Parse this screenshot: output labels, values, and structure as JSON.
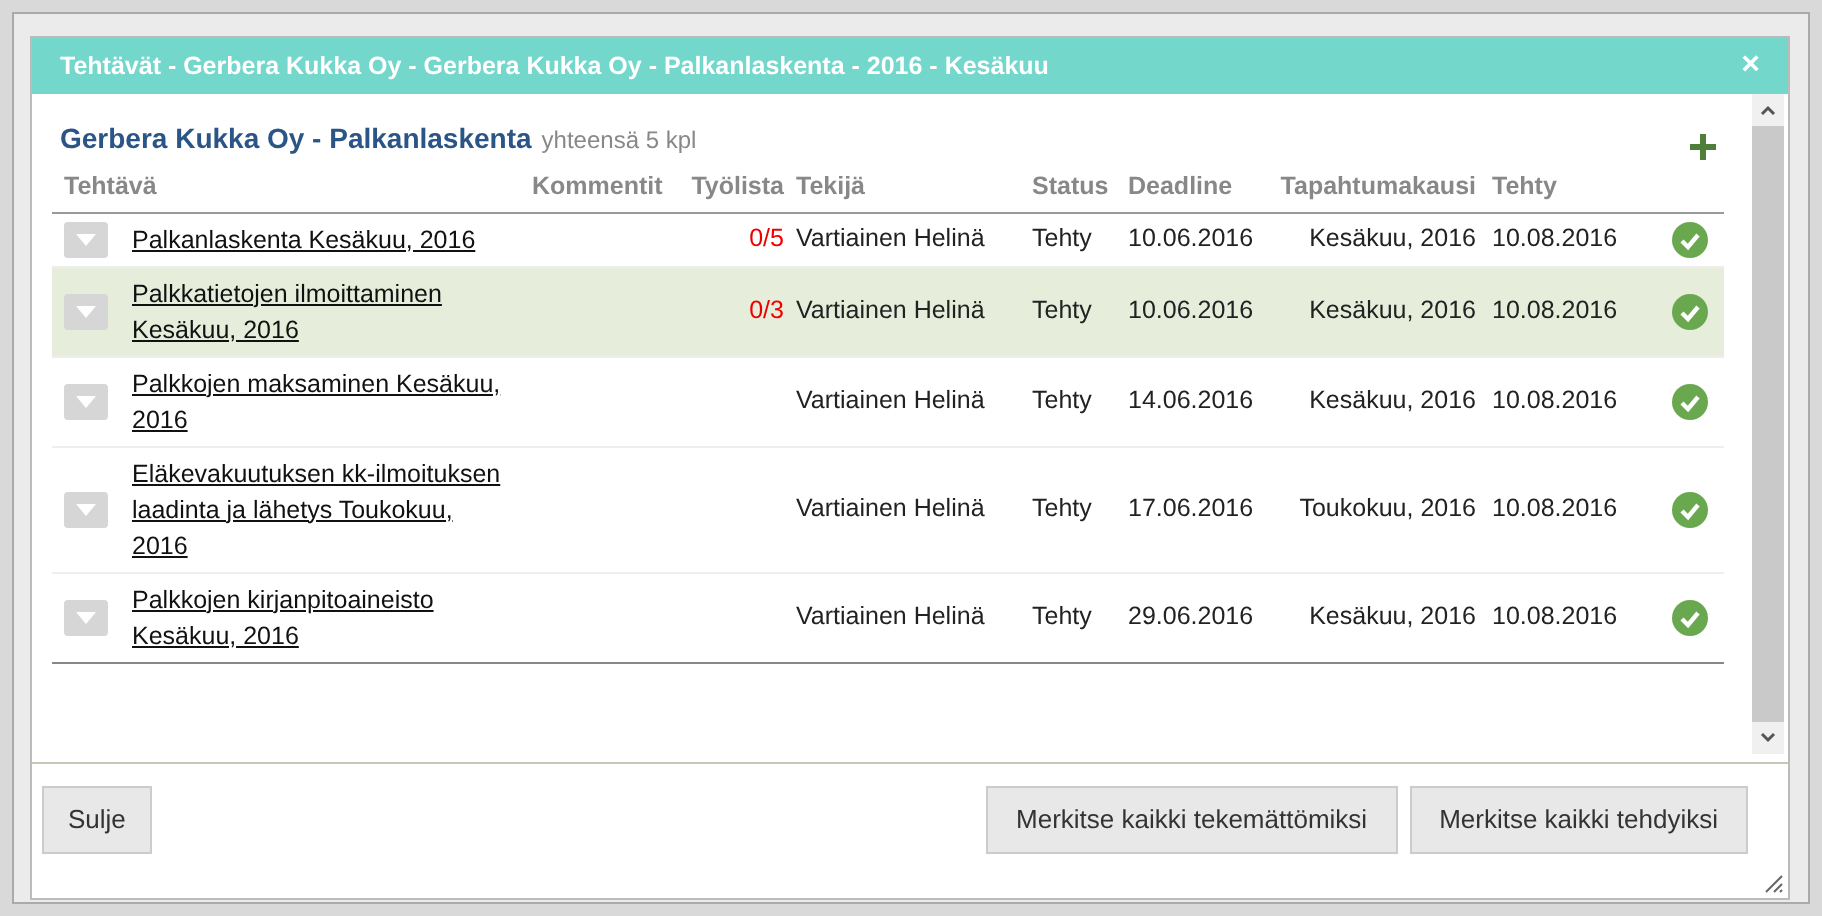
{
  "window": {
    "title": "Tehtävät - Gerbera Kukka Oy - Gerbera Kukka Oy - Palkanlaskenta - 2016 - Kesäkuu",
    "close": "×"
  },
  "heading": {
    "title": "Gerbera Kukka Oy - Palkanlaskenta",
    "count": "yhteensä 5 kpl"
  },
  "table": {
    "columns": [
      "Tehtävä",
      "Kommentit",
      "Työlista",
      "Tekijä",
      "Status",
      "Deadline",
      "Tapahtumakausi",
      "Tehty"
    ],
    "rows": [
      {
        "task": "Palkanlaskenta Kesäkuu, 2016",
        "worklist": "0/5",
        "assignee": "Vartiainen Helinä",
        "status": "Tehty",
        "deadline": "10.06.2016",
        "period": "Kesäkuu, 2016",
        "done_date": "10.08.2016",
        "done": true,
        "selected": false
      },
      {
        "task": "Palkkatietojen ilmoittaminen Kesäkuu, 2016",
        "worklist": "0/3",
        "assignee": "Vartiainen Helinä",
        "status": "Tehty",
        "deadline": "10.06.2016",
        "period": "Kesäkuu, 2016",
        "done_date": "10.08.2016",
        "done": true,
        "selected": true
      },
      {
        "task": "Palkkojen maksaminen Kesäkuu, 2016",
        "assignee": "Vartiainen Helinä",
        "status": "Tehty",
        "deadline": "14.06.2016",
        "period": "Kesäkuu, 2016",
        "done_date": "10.08.2016",
        "done": true,
        "selected": false
      },
      {
        "task": "Eläkevakuutuksen kk-ilmoituksen laadinta ja lähetys Toukokuu, 2016",
        "assignee": "Vartiainen Helinä",
        "status": "Tehty",
        "deadline": "17.06.2016",
        "period": "Toukokuu, 2016",
        "done_date": "10.08.2016",
        "done": true,
        "selected": false
      },
      {
        "task": "Palkkojen kirjanpitoaineisto Kesäkuu, 2016",
        "assignee": "Vartiainen Helinä",
        "status": "Tehty",
        "deadline": "29.06.2016",
        "period": "Kesäkuu, 2016",
        "done_date": "10.08.2016",
        "done": true,
        "selected": false
      }
    ]
  },
  "buttons": {
    "close": "Sulje",
    "actions": [
      "Merkitse kaikki tekemättömiksi",
      "Merkitse kaikki tehdyiksi"
    ]
  }
}
